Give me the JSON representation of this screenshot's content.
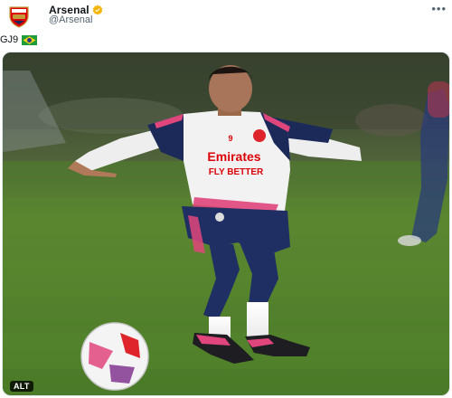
{
  "tweet": {
    "author": {
      "display_name": "Arsenal",
      "handle": "@Arsenal",
      "avatar_icon": "arsenal-crest-icon",
      "verified_icon": "verified-badge-icon",
      "verified_color": "#f4b400"
    },
    "more_label": "•••",
    "text": "GJ9",
    "text_emoji": "brazil-flag-icon",
    "media": {
      "alt_label": "ALT",
      "shirt_sponsor": "Emirates",
      "shirt_slogan": "FLY BETTER",
      "shirt_number": "9"
    }
  },
  "colors": {
    "pitch": "#4f7f2a",
    "arsenal_red": "#db0007",
    "kit_navy": "#1c2a5a",
    "kit_pink": "#e0457b"
  }
}
